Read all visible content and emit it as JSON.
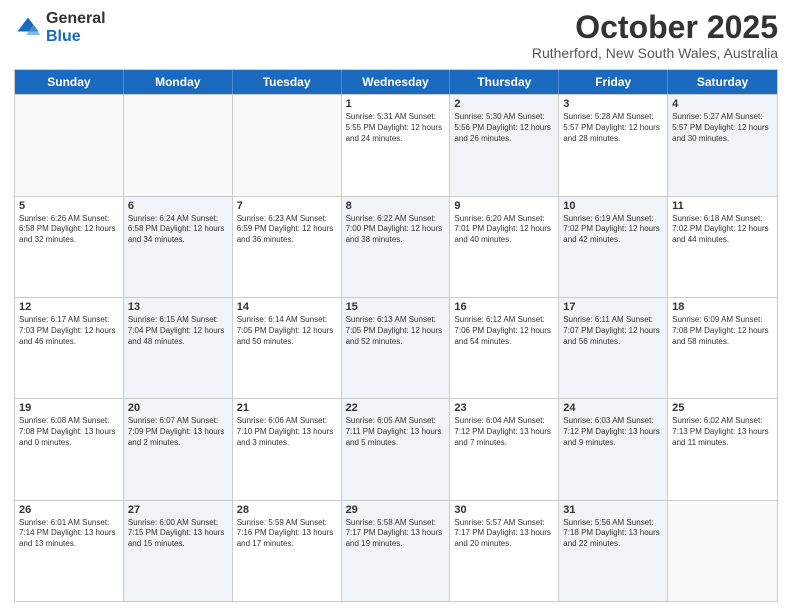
{
  "logo": {
    "general": "General",
    "blue": "Blue"
  },
  "header": {
    "month": "October 2025",
    "location": "Rutherford, New South Wales, Australia"
  },
  "weekdays": [
    "Sunday",
    "Monday",
    "Tuesday",
    "Wednesday",
    "Thursday",
    "Friday",
    "Saturday"
  ],
  "rows": [
    [
      {
        "day": "",
        "info": "",
        "shaded": false,
        "empty": true
      },
      {
        "day": "",
        "info": "",
        "shaded": false,
        "empty": true
      },
      {
        "day": "",
        "info": "",
        "shaded": false,
        "empty": true
      },
      {
        "day": "1",
        "info": "Sunrise: 5:31 AM\nSunset: 5:55 PM\nDaylight: 12 hours\nand 24 minutes.",
        "shaded": false,
        "empty": false
      },
      {
        "day": "2",
        "info": "Sunrise: 5:30 AM\nSunset: 5:56 PM\nDaylight: 12 hours\nand 26 minutes.",
        "shaded": true,
        "empty": false
      },
      {
        "day": "3",
        "info": "Sunrise: 5:28 AM\nSunset: 5:57 PM\nDaylight: 12 hours\nand 28 minutes.",
        "shaded": false,
        "empty": false
      },
      {
        "day": "4",
        "info": "Sunrise: 5:27 AM\nSunset: 5:57 PM\nDaylight: 12 hours\nand 30 minutes.",
        "shaded": true,
        "empty": false
      }
    ],
    [
      {
        "day": "5",
        "info": "Sunrise: 6:26 AM\nSunset: 6:58 PM\nDaylight: 12 hours\nand 32 minutes.",
        "shaded": false,
        "empty": false
      },
      {
        "day": "6",
        "info": "Sunrise: 6:24 AM\nSunset: 6:58 PM\nDaylight: 12 hours\nand 34 minutes.",
        "shaded": true,
        "empty": false
      },
      {
        "day": "7",
        "info": "Sunrise: 6:23 AM\nSunset: 6:59 PM\nDaylight: 12 hours\nand 36 minutes.",
        "shaded": false,
        "empty": false
      },
      {
        "day": "8",
        "info": "Sunrise: 6:22 AM\nSunset: 7:00 PM\nDaylight: 12 hours\nand 38 minutes.",
        "shaded": true,
        "empty": false
      },
      {
        "day": "9",
        "info": "Sunrise: 6:20 AM\nSunset: 7:01 PM\nDaylight: 12 hours\nand 40 minutes.",
        "shaded": false,
        "empty": false
      },
      {
        "day": "10",
        "info": "Sunrise: 6:19 AM\nSunset: 7:02 PM\nDaylight: 12 hours\nand 42 minutes.",
        "shaded": true,
        "empty": false
      },
      {
        "day": "11",
        "info": "Sunrise: 6:18 AM\nSunset: 7:02 PM\nDaylight: 12 hours\nand 44 minutes.",
        "shaded": false,
        "empty": false
      }
    ],
    [
      {
        "day": "12",
        "info": "Sunrise: 6:17 AM\nSunset: 7:03 PM\nDaylight: 12 hours\nand 46 minutes.",
        "shaded": false,
        "empty": false
      },
      {
        "day": "13",
        "info": "Sunrise: 6:15 AM\nSunset: 7:04 PM\nDaylight: 12 hours\nand 48 minutes.",
        "shaded": true,
        "empty": false
      },
      {
        "day": "14",
        "info": "Sunrise: 6:14 AM\nSunset: 7:05 PM\nDaylight: 12 hours\nand 50 minutes.",
        "shaded": false,
        "empty": false
      },
      {
        "day": "15",
        "info": "Sunrise: 6:13 AM\nSunset: 7:05 PM\nDaylight: 12 hours\nand 52 minutes.",
        "shaded": true,
        "empty": false
      },
      {
        "day": "16",
        "info": "Sunrise: 6:12 AM\nSunset: 7:06 PM\nDaylight: 12 hours\nand 54 minutes.",
        "shaded": false,
        "empty": false
      },
      {
        "day": "17",
        "info": "Sunrise: 6:11 AM\nSunset: 7:07 PM\nDaylight: 12 hours\nand 56 minutes.",
        "shaded": true,
        "empty": false
      },
      {
        "day": "18",
        "info": "Sunrise: 6:09 AM\nSunset: 7:08 PM\nDaylight: 12 hours\nand 58 minutes.",
        "shaded": false,
        "empty": false
      }
    ],
    [
      {
        "day": "19",
        "info": "Sunrise: 6:08 AM\nSunset: 7:08 PM\nDaylight: 13 hours\nand 0 minutes.",
        "shaded": false,
        "empty": false
      },
      {
        "day": "20",
        "info": "Sunrise: 6:07 AM\nSunset: 7:09 PM\nDaylight: 13 hours\nand 2 minutes.",
        "shaded": true,
        "empty": false
      },
      {
        "day": "21",
        "info": "Sunrise: 6:06 AM\nSunset: 7:10 PM\nDaylight: 13 hours\nand 3 minutes.",
        "shaded": false,
        "empty": false
      },
      {
        "day": "22",
        "info": "Sunrise: 6:05 AM\nSunset: 7:11 PM\nDaylight: 13 hours\nand 5 minutes.",
        "shaded": true,
        "empty": false
      },
      {
        "day": "23",
        "info": "Sunrise: 6:04 AM\nSunset: 7:12 PM\nDaylight: 13 hours\nand 7 minutes.",
        "shaded": false,
        "empty": false
      },
      {
        "day": "24",
        "info": "Sunrise: 6:03 AM\nSunset: 7:12 PM\nDaylight: 13 hours\nand 9 minutes.",
        "shaded": true,
        "empty": false
      },
      {
        "day": "25",
        "info": "Sunrise: 6:02 AM\nSunset: 7:13 PM\nDaylight: 13 hours\nand 11 minutes.",
        "shaded": false,
        "empty": false
      }
    ],
    [
      {
        "day": "26",
        "info": "Sunrise: 6:01 AM\nSunset: 7:14 PM\nDaylight: 13 hours\nand 13 minutes.",
        "shaded": false,
        "empty": false
      },
      {
        "day": "27",
        "info": "Sunrise: 6:00 AM\nSunset: 7:15 PM\nDaylight: 13 hours\nand 15 minutes.",
        "shaded": true,
        "empty": false
      },
      {
        "day": "28",
        "info": "Sunrise: 5:59 AM\nSunset: 7:16 PM\nDaylight: 13 hours\nand 17 minutes.",
        "shaded": false,
        "empty": false
      },
      {
        "day": "29",
        "info": "Sunrise: 5:58 AM\nSunset: 7:17 PM\nDaylight: 13 hours\nand 19 minutes.",
        "shaded": true,
        "empty": false
      },
      {
        "day": "30",
        "info": "Sunrise: 5:57 AM\nSunset: 7:17 PM\nDaylight: 13 hours\nand 20 minutes.",
        "shaded": false,
        "empty": false
      },
      {
        "day": "31",
        "info": "Sunrise: 5:56 AM\nSunset: 7:18 PM\nDaylight: 13 hours\nand 22 minutes.",
        "shaded": true,
        "empty": false
      },
      {
        "day": "",
        "info": "",
        "shaded": false,
        "empty": true
      }
    ]
  ]
}
